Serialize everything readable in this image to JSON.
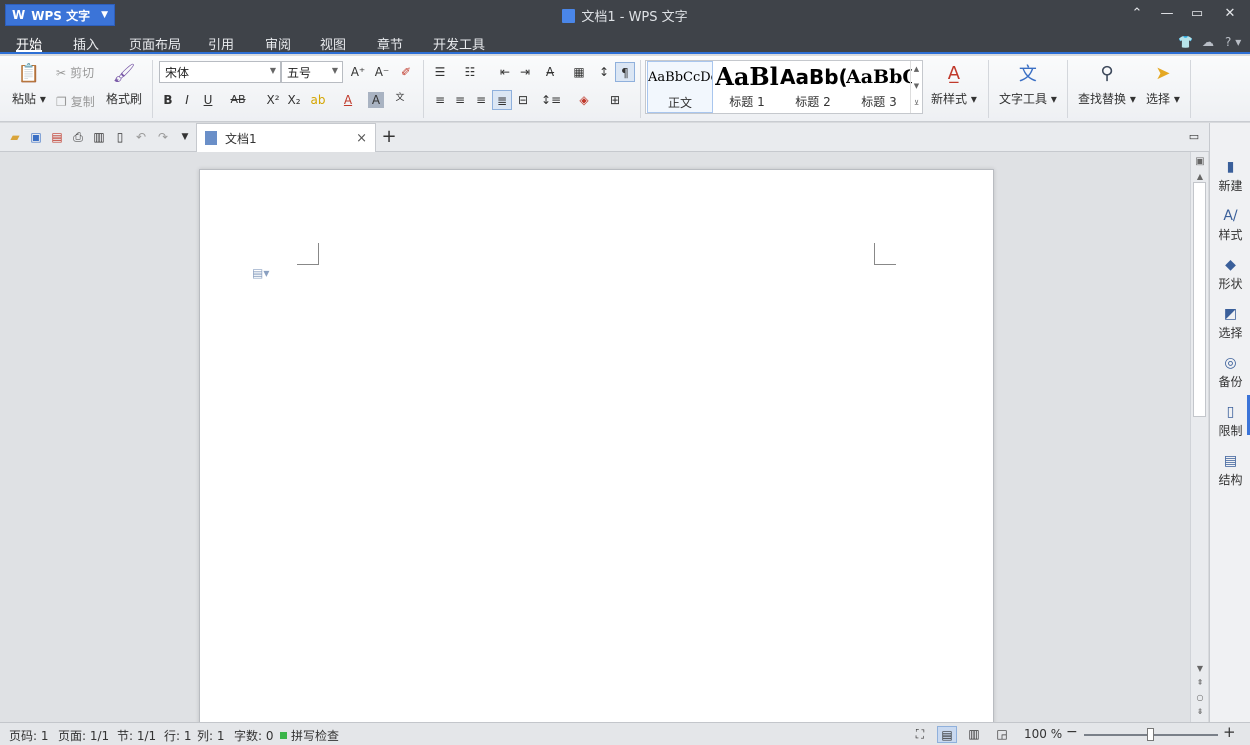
{
  "app": {
    "name": "WPS 文字",
    "title": "文档1 - WPS 文字"
  },
  "window_controls": {
    "collapse": "⌃",
    "minimize": "—",
    "maximize": "▭",
    "close": "✕"
  },
  "menu": {
    "tabs": [
      "开始",
      "插入",
      "页面布局",
      "引用",
      "审阅",
      "视图",
      "章节",
      "开发工具"
    ],
    "help": "?"
  },
  "ribbon": {
    "paste": "粘贴",
    "cut": "剪切",
    "copy": "复制",
    "format_painter": "格式刷",
    "font_name": "宋体",
    "font_size": "五号",
    "styles": [
      {
        "preview": "AaBbCcDd",
        "name": "正文"
      },
      {
        "preview": "AaBl",
        "name": "标题 1"
      },
      {
        "preview": "AaBb(",
        "name": "标题 2"
      },
      {
        "preview": "AaBbC",
        "name": "标题 3"
      }
    ],
    "new_style": "新样式",
    "text_tools": "文字工具",
    "find_replace": "查找替换",
    "select": "选择"
  },
  "doc_tab": {
    "name": "文档1",
    "close": "×",
    "add": "+"
  },
  "side_panel": [
    "新建",
    "样式",
    "形状",
    "选择",
    "备份",
    "限制",
    "结构"
  ],
  "status": {
    "page_no": "页码: 1",
    "page": "页面: 1/1",
    "section": "节: 1/1",
    "row": "行: 1",
    "col": "列: 1",
    "word_count": "字数: 0",
    "spell_check": "拼写检查",
    "zoom": "100 %",
    "zoom_level": 0.5
  },
  "colors": {
    "accent": "#2d6fd5",
    "titlebar": "#3f4349",
    "app_button": "#3b74d8"
  }
}
